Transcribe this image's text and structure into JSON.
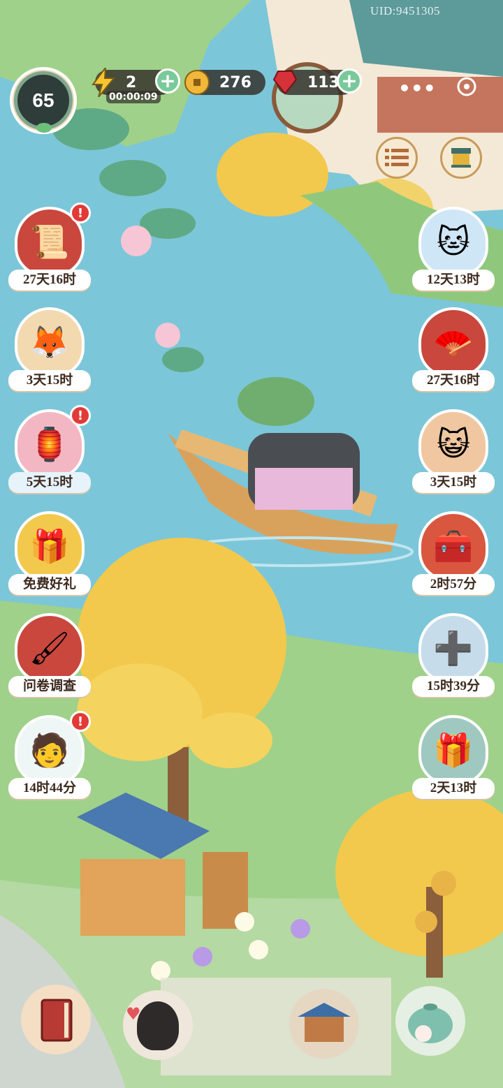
{
  "uid": "UID:9451305",
  "player": {
    "level": "65"
  },
  "resources": {
    "energy": {
      "value": "2",
      "timer": "00:00:09",
      "icon": "lightning-icon"
    },
    "coins": {
      "value": "276",
      "icon": "coin-icon"
    },
    "gems": {
      "value": "113",
      "icon": "ruby-icon"
    }
  },
  "plus_glyph": "+",
  "more_glyph": "•••",
  "left_events": [
    {
      "label": "27天16时",
      "badge": "!"
    },
    {
      "label": "3天15时"
    },
    {
      "label": "5天15时",
      "badge": "!"
    },
    {
      "label": "免费好礼"
    },
    {
      "label": "问卷调查"
    },
    {
      "label": "14时44分",
      "badge": "!"
    }
  ],
  "right_events": [
    {
      "label": "12天13时"
    },
    {
      "label": "27天16时"
    },
    {
      "label": "3天15时"
    },
    {
      "label": "2时57分"
    },
    {
      "label": "15时39分"
    },
    {
      "label": "2天13时"
    }
  ],
  "colors": {
    "water": "#7cc6d9",
    "grass": "#9fd18a",
    "tree_gold": "#f2c94c",
    "badge_red": "#e23a36"
  }
}
